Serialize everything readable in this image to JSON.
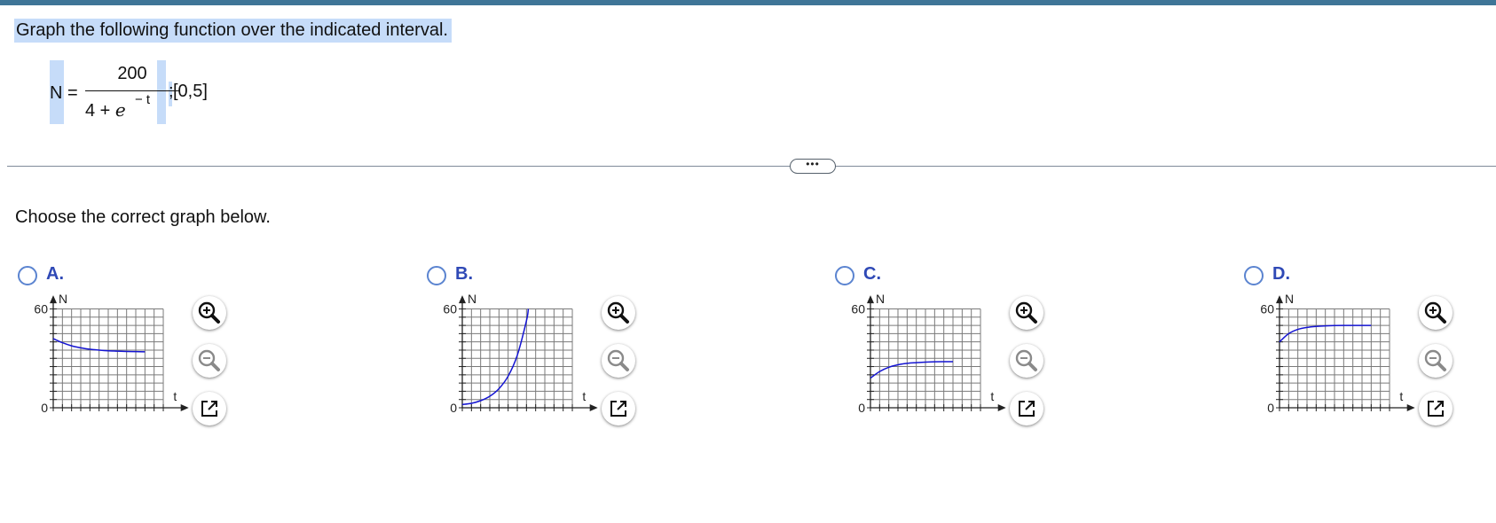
{
  "question": {
    "prompt": "Graph the following function over the indicated interval.",
    "formula": {
      "lhs": "N =",
      "numerator": "200",
      "denominator_constant": "4 +",
      "denominator_base": "e",
      "exponent": "− t",
      "separator": ";",
      "interval": "[0,5]"
    }
  },
  "expand": {
    "label": "•••"
  },
  "instruction": "Choose the correct graph below.",
  "graph_labels": {
    "y_axis": "N",
    "x_axis": "t",
    "y_max": "60",
    "y_min": "0",
    "x_min": "0",
    "x_max": "6"
  },
  "colors": {
    "curve": "#1414d2",
    "option_label": "#2f49b6",
    "radio": "#5b84d0",
    "highlight": "#c6dcf9",
    "top_bar": "#3f7597"
  },
  "options": [
    {
      "label": "A.",
      "curve_desc": "decreasing from 42 toward 34 over [0,5]"
    },
    {
      "label": "B.",
      "curve_desc": "exponential increase from 2 to 60 over [0,3.6]"
    },
    {
      "label": "C.",
      "curve_desc": "increasing from 18 toward 28 over [0,4.5]"
    },
    {
      "label": "D.",
      "curve_desc": "increasing from 40 toward 50 over [0,5]"
    }
  ],
  "chart_data": [
    {
      "type": "line",
      "title": "A.",
      "xlabel": "t",
      "ylabel": "N",
      "xlim": [
        0,
        6
      ],
      "ylim": [
        0,
        60
      ],
      "series": [
        {
          "x": [
            0,
            0.5,
            1,
            1.5,
            2,
            2.5,
            3,
            3.5,
            4,
            4.5,
            5
          ],
          "values": [
            42,
            39.5,
            37.6,
            36.4,
            35.5,
            35.0,
            34.6,
            34.4,
            34.2,
            34.1,
            34.0
          ]
        }
      ]
    },
    {
      "type": "line",
      "title": "B.",
      "xlabel": "t",
      "ylabel": "N",
      "xlim": [
        0,
        6
      ],
      "ylim": [
        0,
        60
      ],
      "series": [
        {
          "x": [
            0,
            0.5,
            1,
            1.5,
            2,
            2.5,
            3,
            3.5,
            3.6
          ],
          "values": [
            2,
            2.7,
            4.3,
            7.0,
            11.6,
            19.2,
            31.9,
            52.9,
            60
          ]
        }
      ]
    },
    {
      "type": "line",
      "title": "C.",
      "xlabel": "t",
      "ylabel": "N",
      "xlim": [
        0,
        6
      ],
      "ylim": [
        0,
        60
      ],
      "series": [
        {
          "x": [
            0,
            0.5,
            1,
            1.5,
            2,
            2.5,
            3,
            3.5,
            4,
            4.5
          ],
          "values": [
            18.0,
            22.0,
            24.6,
            26.1,
            27.0,
            27.4,
            27.7,
            27.9,
            28.0,
            28.0
          ]
        }
      ]
    },
    {
      "type": "line",
      "title": "D.",
      "xlabel": "t",
      "ylabel": "N",
      "xlim": [
        0,
        6
      ],
      "ylim": [
        0,
        60
      ],
      "series": [
        {
          "x": [
            0,
            0.5,
            1,
            1.5,
            2,
            2.5,
            3,
            3.5,
            4,
            4.5,
            5
          ],
          "values": [
            40,
            45.0,
            47.6,
            48.8,
            49.4,
            49.7,
            49.9,
            50.0,
            50.0,
            50.0,
            50.0
          ]
        }
      ]
    }
  ]
}
